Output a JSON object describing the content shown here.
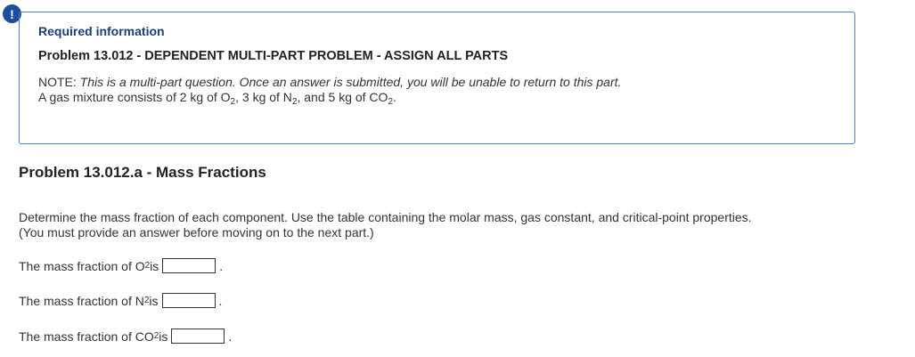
{
  "alert_icon": "exclamation-icon",
  "info": {
    "heading": "Required information",
    "problem_title": "Problem 13.012 - DEPENDENT MULTI-PART PROBLEM - ASSIGN ALL PARTS",
    "note_prefix": "NOTE: ",
    "note_text": "This is a multi-part question. Once an answer is submitted, you will be unable to return to this part.",
    "setup_prefix": "A gas mixture consists of 2 kg of O",
    "setup_sub1": "2",
    "setup_mid1": ", 3 kg of N",
    "setup_sub2": "2",
    "setup_mid2": ", and 5 kg of CO",
    "setup_sub3": "2",
    "setup_end": "."
  },
  "part": {
    "title": "Problem 13.012.a - Mass Fractions",
    "instruction_line1": "Determine the mass fraction of each component. Use the table containing the molar mass, gas constant, and critical-point properties.",
    "instruction_line2": "(You must provide an answer before moving on to the next part.)"
  },
  "questions": [
    {
      "prefix": "The mass fraction of O",
      "sub": "2",
      "suffix": " is",
      "value": "",
      "end": "."
    },
    {
      "prefix": "The mass fraction of N",
      "sub": "2",
      "suffix": " is",
      "value": "",
      "end": "."
    },
    {
      "prefix": "The mass fraction of CO",
      "sub": "2",
      "suffix": " is",
      "value": "",
      "end": "."
    }
  ]
}
